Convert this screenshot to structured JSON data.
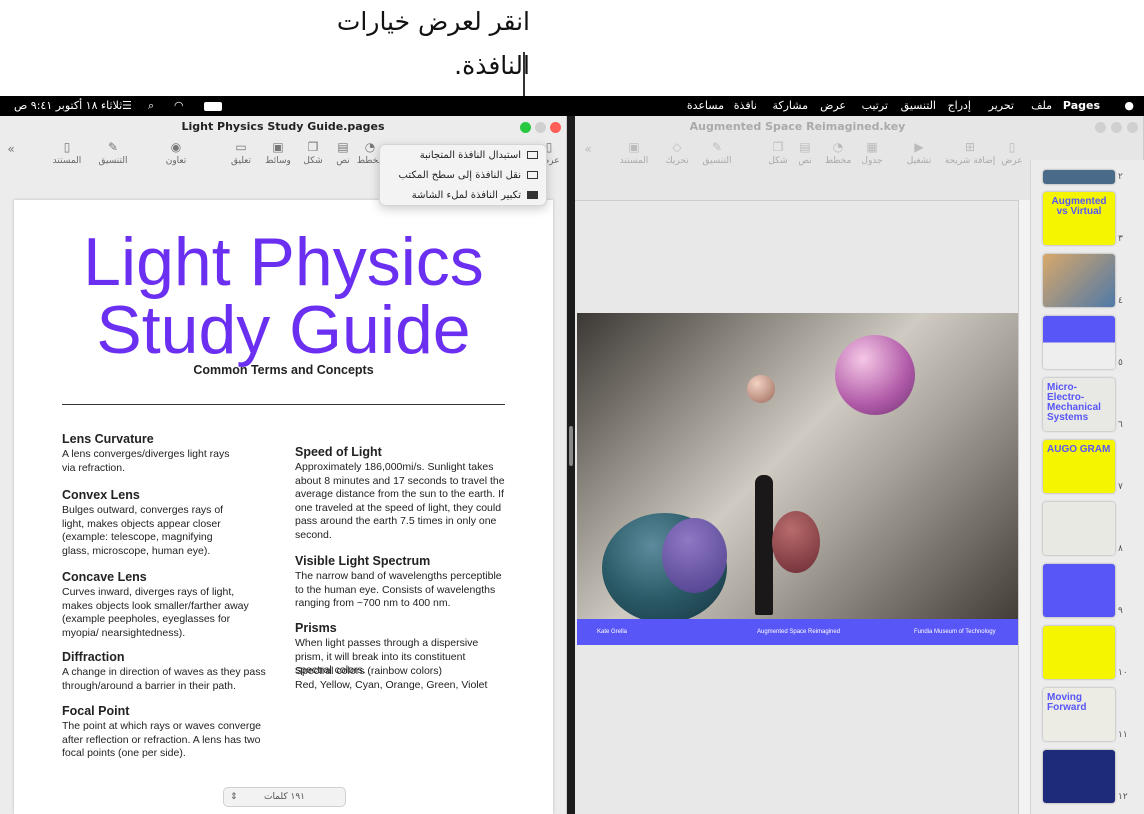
{
  "callout": {
    "text": "انقر لعرض خيارات النافذة."
  },
  "menubar": {
    "apple": "",
    "app": "Pages",
    "items": [
      "ملف",
      "تحرير",
      "إدراج",
      "التنسيق",
      "ترتيب",
      "عرض",
      "مشاركة",
      "نافذة",
      "مساعدة"
    ],
    "clock": "ثلاثاء ١٨ أكتوبر ٩:٤١ ص"
  },
  "pages_window": {
    "title": "Light Physics Study Guide.pages",
    "toolbar": [
      {
        "label": "عرض",
        "icon": "sidebar-icon"
      },
      {
        "label": "مخطط",
        "icon": "chart-icon"
      },
      {
        "label": "نص",
        "icon": "text-icon"
      },
      {
        "label": "شكل",
        "icon": "shape-icon"
      },
      {
        "label": "وسائط",
        "icon": "media-icon"
      },
      {
        "label": "تعليق",
        "icon": "comment-icon"
      },
      {
        "label": "تعاون",
        "icon": "collaborate-icon"
      },
      {
        "label": "التنسيق",
        "icon": "format-icon"
      },
      {
        "label": "المستند",
        "icon": "document-icon"
      }
    ],
    "popup": [
      "استبدال النافذة المتجانبة",
      "نقل النافذة إلى سطح المكتب",
      "تكبير النافذة لملء الشاشة"
    ],
    "doc": {
      "title1": "Light Physics",
      "title2": "Study Guide",
      "subtitle": "Common Terms and Concepts",
      "left": [
        {
          "h": "Lens Curvature",
          "p": "A lens converges/diverges light rays via refraction."
        },
        {
          "h": "Convex Lens",
          "p": "Bulges outward, converges rays of light, makes objects appear closer (example: telescope, magnifying glass, microscope, human eye)."
        },
        {
          "h": "Concave Lens",
          "p": "Curves inward, diverges rays of light, makes objects look smaller/farther away (example peepholes, eyeglasses for myopia/ nearsightedness)."
        },
        {
          "h": "Diffraction",
          "p": "A change in direction of waves as they pass through/around a barrier in their path."
        },
        {
          "h": "Focal Point",
          "p": "The point at which rays or waves converge after reflection or refraction. A lens has two focal points (one per side)."
        }
      ],
      "right": [
        {
          "h": "Speed of Light",
          "p": "Approximately 186,000mi/s. Sunlight takes about 8 minutes and 17 seconds to travel the average distance from the sun to the earth. If one traveled at the speed of light, they could pass around the earth 7.5 times in only one second."
        },
        {
          "h": "Visible Light Spectrum",
          "p": "The narrow band of wavelengths perceptible to the human eye. Consists of wavelengths ranging from ~700 nm to 400 nm."
        },
        {
          "h": "Prisms",
          "p": "When light passes through a dispersive prism, it will break into its constituent spectral colors."
        }
      ],
      "spectral": "Spectral colors (rainbow colors)",
      "colors": "Red, Yellow, Cyan, Orange, Green, Violet"
    },
    "word_count": "١٩١ كلمات"
  },
  "keynote_window": {
    "title": "Augmented Space Reimagined.key",
    "toolbar": [
      {
        "label": "عرض",
        "icon": "sidebar-icon"
      },
      {
        "label": "إضافة شريحة",
        "icon": "add-slide-icon"
      },
      {
        "label": "تشغيل",
        "icon": "play-icon"
      },
      {
        "label": "جدول",
        "icon": "table-icon"
      },
      {
        "label": "مخطط",
        "icon": "chart-icon"
      },
      {
        "label": "نص",
        "icon": "text-icon"
      },
      {
        "label": "شكل",
        "icon": "shape-icon"
      },
      {
        "label": "التنسيق",
        "icon": "format-icon"
      },
      {
        "label": "تحريك",
        "icon": "animate-icon"
      },
      {
        "label": "المستند",
        "icon": "document-icon"
      }
    ],
    "slide_footer": [
      "Kate Grella",
      "Augmented Space Reimagined",
      "Fundia Museum of Technology"
    ],
    "thumbs": [
      {
        "n": "٢"
      },
      {
        "n": "٣",
        "t": "Augmented vs Virtual"
      },
      {
        "n": "٤"
      },
      {
        "n": "٥"
      },
      {
        "n": "٦",
        "t": "Micro-Electro-Mechanical Systems"
      },
      {
        "n": "٧",
        "t": "AUGO GRAM"
      },
      {
        "n": "٨"
      },
      {
        "n": "٩"
      },
      {
        "n": "١٠"
      },
      {
        "n": "١١",
        "t": "Moving Forward"
      },
      {
        "n": "١٢"
      }
    ]
  },
  "colors": {
    "accent_purple": "#6a2ff0",
    "slide_blue": "#5856f7",
    "slide_yellow": "#f5f500",
    "zoom_green": "#28c840",
    "close_red": "#ff5f57"
  }
}
